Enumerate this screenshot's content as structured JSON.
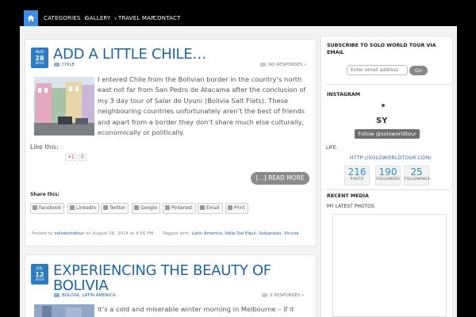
{
  "nav": {
    "items": [
      {
        "label": "CATEGORIES",
        "has_caret": true
      },
      {
        "label": "GALLERY",
        "has_caret": true
      },
      {
        "label": "TRAVEL MAP",
        "has_caret": false
      },
      {
        "label": "CONTACT",
        "has_caret": false
      }
    ],
    "home_icon": "home-icon",
    "accent": "#3a8ee6"
  },
  "posts": [
    {
      "date": {
        "month": "AUG",
        "day": "28",
        "year": "2014"
      },
      "title": "ADD A LITTLE CHILE…",
      "category": "CHILE",
      "comments": "NO RESPONSES »",
      "excerpt": "I entered Chile from the Bolivian border in the country’s north east not far from San Pedro de Atacama after the conclusion of my 3 day tour of Salar de Uyuni (Bolivia Salt Flats). These neighbouring countries unfortunately aren’t the best of friends and apart from a border they don’t share much else culturally, economically or politically.",
      "like_this": "Like this:",
      "gplus_label": "+1",
      "gplus_count": "0",
      "read_more": "[…] READ MORE",
      "share_title": "Share this:",
      "share_buttons": [
        "Facebook",
        "LinkedIn",
        "Twitter",
        "Google",
        "Pinterest",
        "Email",
        "Print"
      ],
      "posted_by_prefix": "Posted by",
      "author": "soloworldtour",
      "posted_on": "on August 28, 2014 at 4:56 PM",
      "tagged_prefix": "Tagged with:",
      "tags": "Latin America, Valle Del Elqui, Valparaiso, Vicuna"
    },
    {
      "date": {
        "month": "JUL",
        "day": "12",
        "year": "2014"
      },
      "title_line1": "EXPERIENCING THE BEAUTY OF",
      "title_line2": "BOLIVIA",
      "category": "BOLIVIA, LATIN AMERICA",
      "comments": "2 RESPONSES »",
      "excerpt": "It’s a cold and miserable winter morning in Melbourne – if it wasnt for"
    }
  ],
  "sidebar": {
    "subscribe_heading": "SUBSCRIBE TO SOLO WORLD TOUR VIA EMAIL",
    "email_placeholder": "Enter email address",
    "go_label": "Go",
    "instagram_heading": "INSTAGRAM",
    "insta_initials": "SY",
    "follow_label": "Follow @soloworldtour",
    "life": "LIFE.",
    "insta_url": "HTTP://SOLOWORLDTOUR.COM/",
    "stats": [
      {
        "value": "216",
        "label": "PHOTO"
      },
      {
        "value": "190",
        "label": "FOLLOWERS"
      },
      {
        "value": "25",
        "label": "FOLLOWINGS"
      }
    ],
    "recent_media_heading": "RECENT MEDIA",
    "latest_photos": "MY LATEST PHOTOS"
  }
}
